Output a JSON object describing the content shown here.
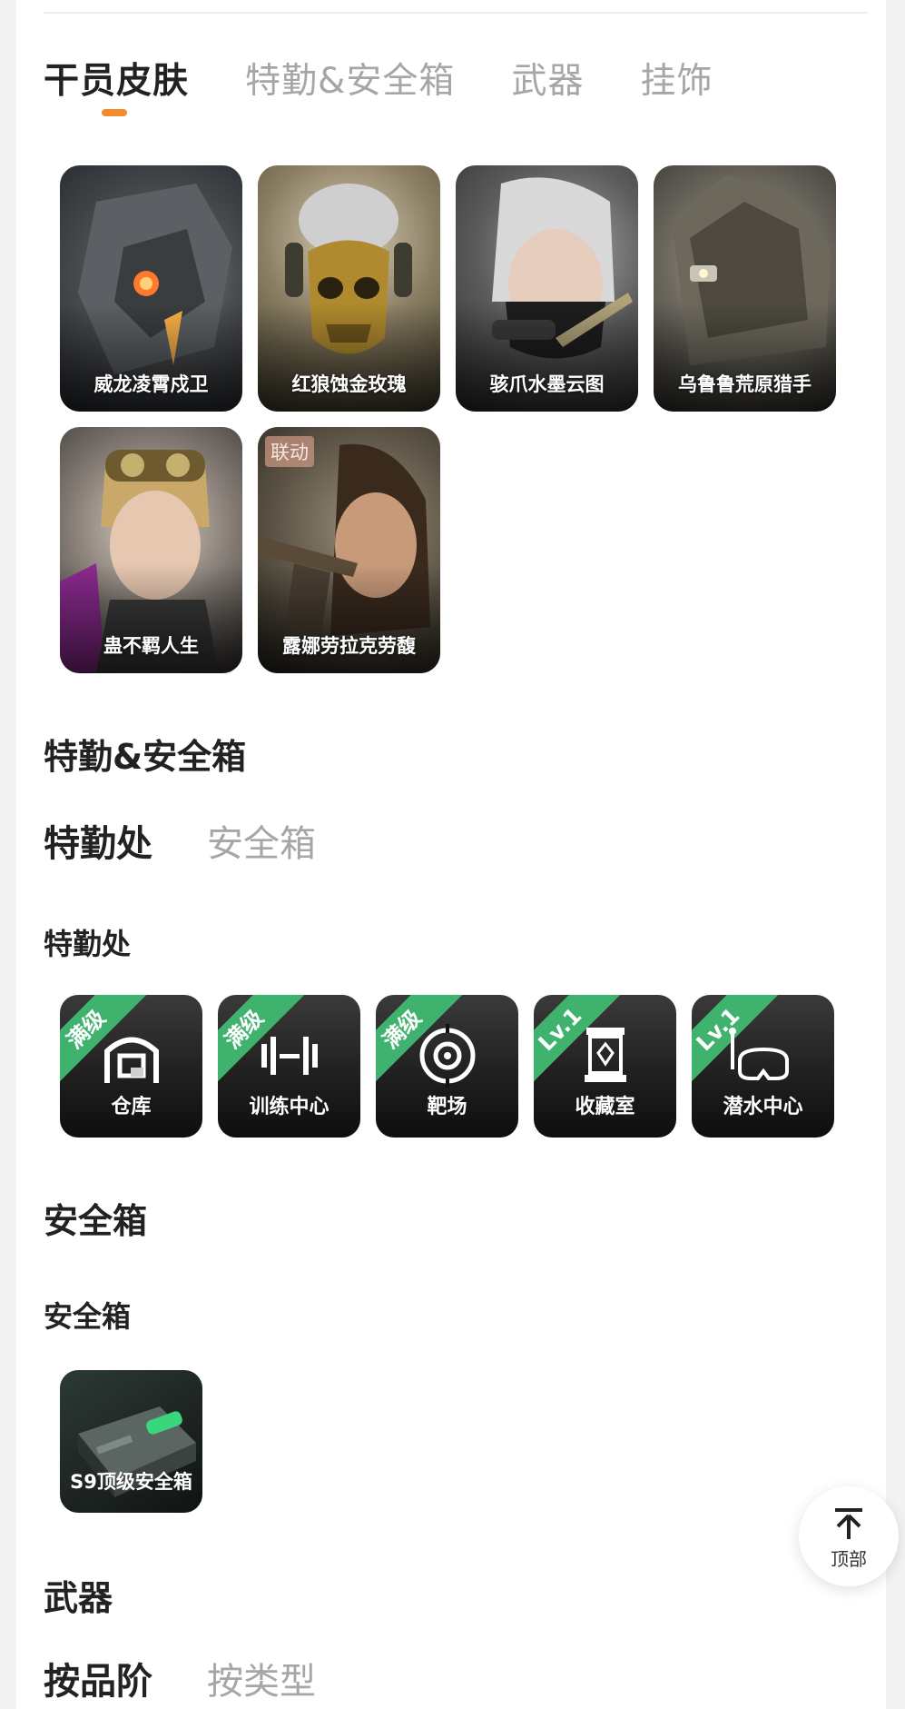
{
  "top_tabs": [
    {
      "label": "干员皮肤",
      "active": true
    },
    {
      "label": "特勤&安全箱",
      "active": false
    },
    {
      "label": "武器",
      "active": false
    },
    {
      "label": "挂饰",
      "active": false
    }
  ],
  "skins": [
    {
      "name": "威龙凌霄戍卫",
      "icon": "armored-soldier-portrait",
      "badge": ""
    },
    {
      "name": "红狼蚀金玫瑰",
      "icon": "gold-skull-mask-portrait",
      "badge": ""
    },
    {
      "name": "骇爪水墨云图",
      "icon": "masked-woman-portrait",
      "badge": ""
    },
    {
      "name": "乌鲁鲁荒原猎手",
      "icon": "ghillie-hunter-portrait",
      "badge": ""
    },
    {
      "name": "蛊不羁人生",
      "icon": "goggles-woman-portrait",
      "badge": ""
    },
    {
      "name": "露娜劳拉克劳馥",
      "icon": "archer-woman-portrait",
      "badge": "联动"
    }
  ],
  "special_section": {
    "title": "特勤&安全箱",
    "subtabs": [
      {
        "label": "特勤处",
        "active": true
      },
      {
        "label": "安全箱",
        "active": false
      }
    ],
    "group_title": "特勤处",
    "facilities": [
      {
        "name": "仓库",
        "level": "满级",
        "icon": "warehouse-icon"
      },
      {
        "name": "训练中心",
        "level": "满级",
        "icon": "dumbbell-icon"
      },
      {
        "name": "靶场",
        "level": "满级",
        "icon": "target-icon"
      },
      {
        "name": "收藏室",
        "level": "Lv.1",
        "icon": "display-case-icon"
      },
      {
        "name": "潜水中心",
        "level": "Lv.1",
        "icon": "diving-mask-icon"
      }
    ],
    "level_color": "#3fb36e"
  },
  "safebox_section": {
    "title": "安全箱",
    "group_title": "安全箱",
    "items": [
      {
        "name": "S9顶级安全箱",
        "icon": "safebox-icon"
      }
    ]
  },
  "weapon_section": {
    "title": "武器",
    "subtabs": [
      {
        "label": "按品阶",
        "active": true
      },
      {
        "label": "按类型",
        "active": false
      }
    ]
  },
  "back_to_top": {
    "label": "顶部",
    "icon": "arrow-up-to-top-icon"
  },
  "accent_color": "#f08c2c"
}
